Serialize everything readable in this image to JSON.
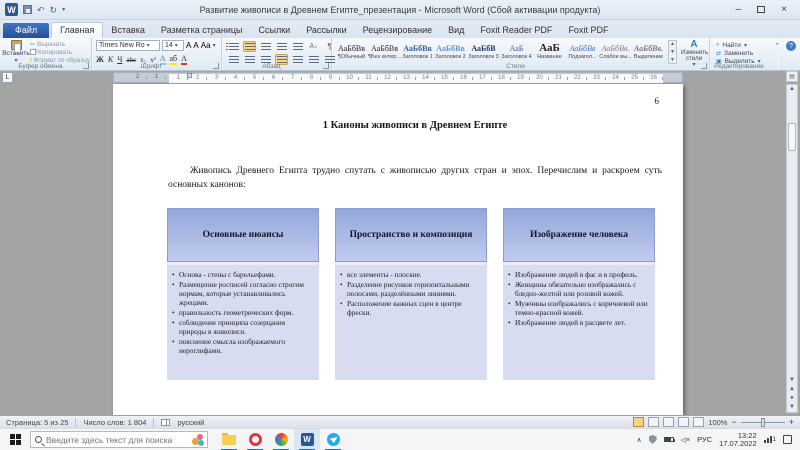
{
  "titlebar": {
    "title": "Развитие живописи в Древнем Египте_презентация - Microsoft Word (Сбой активации продукта)"
  },
  "ribbon": {
    "tabs": [
      "Файл",
      "Главная",
      "Вставка",
      "Разметка страницы",
      "Ссылки",
      "Рассылки",
      "Рецензирование",
      "Вид",
      "Foxit Reader PDF",
      "Foxit PDF"
    ],
    "clipboard": {
      "group": "Буфер обмена",
      "paste": "Вставить",
      "cut": "Вырезать",
      "copy": "Копировать",
      "format_painter": "Формат по образцу"
    },
    "font": {
      "group": "Шрифт",
      "name": "Times New Ro",
      "size": "14",
      "bold": "Ж",
      "italic": "К",
      "underline": "Ч",
      "strike": "abc",
      "subscript": "x₂",
      "superscript": "x²",
      "grow": "А",
      "shrink": "А",
      "change_case": "Аа",
      "effects": "А",
      "highlight": "аб",
      "color": "А"
    },
    "paragraph": {
      "group": "Абзац"
    },
    "styles": {
      "group": "Стили",
      "change": "Изменить стили",
      "items": [
        {
          "sample": "АаБбВв",
          "name": "¶Обычный"
        },
        {
          "sample": "АаБбВв",
          "name": "¶Без интер..."
        },
        {
          "sample": "АаБбВв",
          "name": "Заголовок 1"
        },
        {
          "sample": "АаБбВв",
          "name": "Заголовок 2"
        },
        {
          "sample": "АаБбВ",
          "name": "Заголовок 3"
        },
        {
          "sample": "АаБ",
          "name": "Заголовок 4"
        },
        {
          "sample": "АаБ",
          "name": "Название"
        },
        {
          "sample": "АаБбВв",
          "name": "Подзагол..."
        },
        {
          "sample": "АаБбВв.",
          "name": "Слабое вы..."
        },
        {
          "sample": "АаБбВв.",
          "name": "Выделение"
        }
      ]
    },
    "editing": {
      "group": "Редактирование",
      "find": "Найти",
      "replace": "Заменить",
      "select": "Выделить"
    }
  },
  "ruler": {
    "margin_numbers": [
      "2",
      "1"
    ],
    "cm_numbers": [
      "1",
      "2",
      "3",
      "4",
      "5",
      "6",
      "7",
      "8",
      "9",
      "10",
      "11",
      "12",
      "13",
      "14",
      "15",
      "16",
      "17",
      "18",
      "19",
      "20",
      "21",
      "22",
      "23",
      "24",
      "25",
      "26"
    ]
  },
  "document": {
    "page_number": "6",
    "heading": "1 Каноны живописи в Древнем Египте",
    "paragraph": "Живопись Древнего Египта трудно спутать с живописью других стран и эпох. Перечислим и раскроем суть основных канонов:",
    "boxes": [
      {
        "title": "Основные нюансы",
        "bullets": [
          "Основа - стены с барельефами.",
          "Размещение росписей согласно строгим нормам, которые устанавливались жрецами.",
          "правильность геометрических форм.",
          "соблюдение принципа созерцания природы в живописи.",
          "пояснение смысла изображаемого иероглифами."
        ]
      },
      {
        "title": "Пространство и композиция",
        "bullets": [
          "все элементы - плоские.",
          "Разделение рисунков горизонтальными полосами, разделёнными линиями.",
          "Расположение важных сцен в центре фрески."
        ]
      },
      {
        "title": "Изображение человека",
        "bullets": [
          "Изображение людей в фас и в профиль.",
          "Женщины обязательно изображались с бледно-желтой или розовой кожей.",
          "Мужчины изображались с коричневой или темно-красной кожей.",
          "Изображение людей в расцвете лет."
        ]
      }
    ]
  },
  "statusbar": {
    "page": "Страница: 5 из 25",
    "words": "Число слов: 1 804",
    "language": "русский",
    "zoom": "100%"
  },
  "taskbar": {
    "search_placeholder": "Введите здесь текст для поиска",
    "language": "РУС",
    "time": "13:22",
    "date": "17.07.2022",
    "notification_count": "1"
  },
  "colors": {
    "word_blue": "#2B579A",
    "file_tab_blue": "#3165B5",
    "active_toggle_orange": "#FBD78C",
    "box_header_top": "#94A7DB",
    "box_header_bottom": "#C0CBEE",
    "box_body": "#D7DCF0",
    "taskbar_underline": "#0078D7",
    "document_background": "#A4A4A4"
  }
}
